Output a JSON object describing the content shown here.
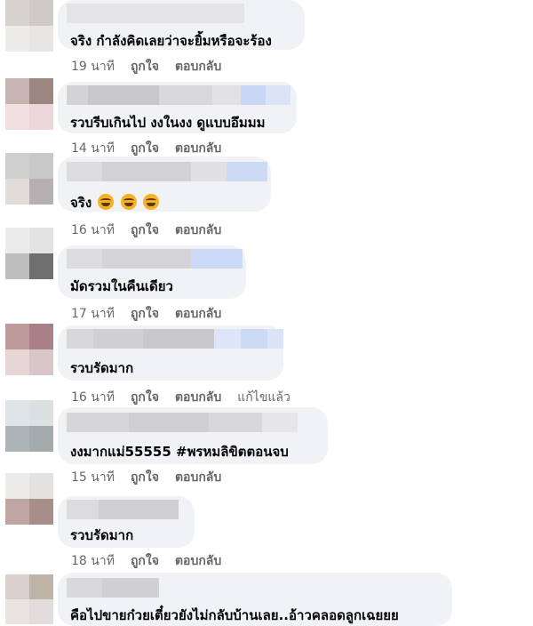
{
  "comments": [
    {
      "text": "จริง กำลังคิดเลยว่าจะยิ้มหรือจะร้อง",
      "time": "19 นาที",
      "like": "ถูกใจ",
      "reply": "ตอบกลับ",
      "edited": ""
    },
    {
      "text": "รวบรีบเกินไป งงในงง ดูแบบอึมมม",
      "time": "14 นาที",
      "like": "ถูกใจ",
      "reply": "ตอบกลับ",
      "edited": ""
    },
    {
      "text": "จริง",
      "time": "16 นาที",
      "like": "ถูกใจ",
      "reply": "ตอบกลับ",
      "edited": ""
    },
    {
      "text": "มัดรวมในคืนเดียว",
      "time": "17 นาที",
      "like": "ถูกใจ",
      "reply": "ตอบกลับ",
      "edited": ""
    },
    {
      "text": "รวบรัดมาก",
      "time": "16 นาที",
      "like": "ถูกใจ",
      "reply": "ตอบกลับ",
      "edited": "แก้ไขแล้ว"
    },
    {
      "text": "งงมากแม่55555 #พรหมลิขิตตอนจบ",
      "time": "15 นาที",
      "like": "ถูกใจ",
      "reply": "ตอบกลับ",
      "edited": ""
    },
    {
      "text": "รวบรัดมาก",
      "time": "18 นาที",
      "like": "ถูกใจ",
      "reply": "ตอบกลับ",
      "edited": ""
    },
    {
      "text": "คือไปขายก๋วยเตี๋ยวยังไม่กลับบ้านเลย..อ้าวคลอดลูกเฉยยย",
      "time": "",
      "like": "",
      "reply": "",
      "edited": ""
    }
  ],
  "emoji": [
    "laughing-emoji",
    "laughing-emoji",
    "laughing-emoji"
  ],
  "colors": {
    "bubble": "#f0f2f5",
    "meta": "#65676b",
    "text": "#050505",
    "emoji": "#f7b125"
  }
}
